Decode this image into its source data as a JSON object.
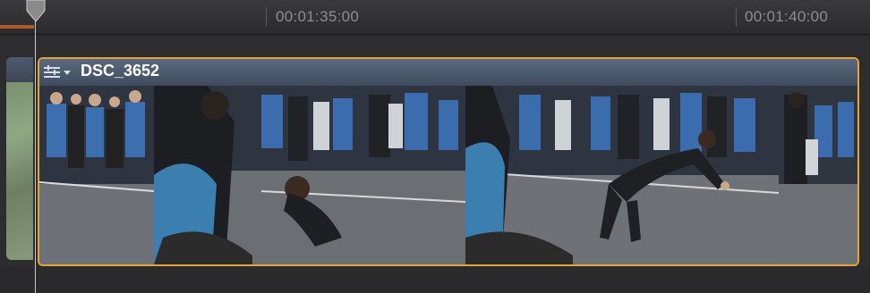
{
  "timeline": {
    "ruler": {
      "timecodes": [
        "00:01:35:00",
        "00:01:40:00"
      ]
    },
    "clip": {
      "name": "DSC_3652",
      "selected": true,
      "selection_color": "#e5a531",
      "header_color": "#4b5a6e",
      "icon": "clip-menu-icon"
    },
    "accent_playhead": "#c8c8c8",
    "ruler_scrub_color": "#b05a2a"
  }
}
